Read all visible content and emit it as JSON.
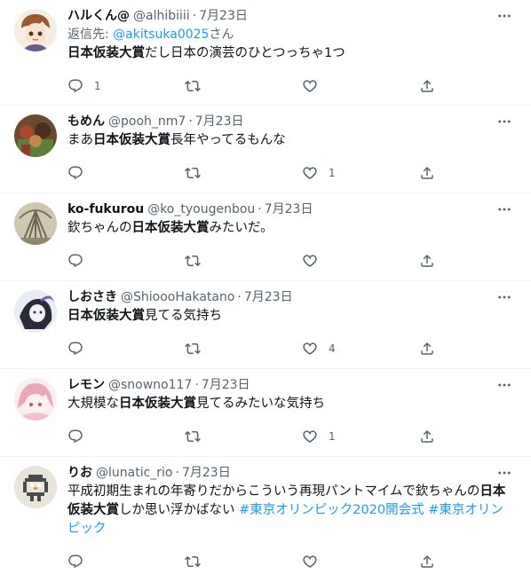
{
  "tweets": [
    {
      "name": "ハルくん@",
      "handle": "@alhibiiii",
      "date": "7月23日",
      "reply_prefix": "返信先: ",
      "reply_to": "@akitsuka0025",
      "reply_suffix": "さん",
      "text_parts": [
        "",
        "日本仮装大賞",
        "だし日本の演芸のひとつっちゃ1つ"
      ],
      "replies": "1",
      "retweets": "",
      "likes": ""
    },
    {
      "name": "もめん",
      "handle": "@pooh_nm7",
      "date": "7月23日",
      "text_parts": [
        "まあ",
        "日本仮装大賞",
        "長年やってるもんな"
      ],
      "replies": "",
      "retweets": "",
      "likes": "1"
    },
    {
      "name": "ko-fukurou",
      "handle": "@ko_tyougenbou",
      "date": "7月23日",
      "text_parts": [
        "欽ちゃんの",
        "日本仮装大賞",
        "みたいだ。"
      ],
      "replies": "",
      "retweets": "",
      "likes": ""
    },
    {
      "name": "しおさき",
      "handle": "@ShioooHakatano",
      "date": "7月23日",
      "text_parts": [
        "",
        "日本仮装大賞",
        "見てる気持ち"
      ],
      "replies": "",
      "retweets": "",
      "likes": "4"
    },
    {
      "name": "レモン",
      "handle": "@snowno117",
      "date": "7月23日",
      "text_parts": [
        "大規模な",
        "日本仮装大賞",
        "見てるみたいな気持ち"
      ],
      "replies": "",
      "retweets": "",
      "likes": "1"
    },
    {
      "name": "りお",
      "handle": "@lunatic_rio",
      "date": "7月23日",
      "text_parts": [
        "平成初期生まれの年寄りだからこういう再現パントマイムで欽ちゃんの",
        "日本仮装大賞",
        "しか思い浮かばない "
      ],
      "hashtags": [
        "#東京オリンピック2020開会式",
        "#東京オリンピック"
      ],
      "replies": "",
      "retweets": "",
      "likes": ""
    }
  ],
  "icons": {
    "reply": "reply-icon",
    "retweet": "retweet-icon",
    "like": "heart-icon",
    "share": "share-icon",
    "more": "more-dots-icon"
  },
  "colors": {
    "text": "#0f1419",
    "secondary": "#536471",
    "link": "#1d9bf0",
    "divider": "#eff3f4"
  }
}
